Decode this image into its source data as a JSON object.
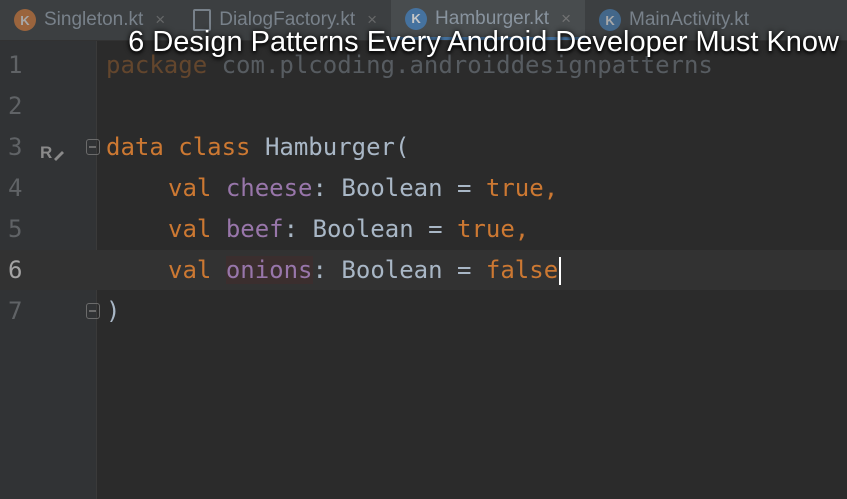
{
  "tabs": [
    {
      "label": "Singleton.kt",
      "icon": "kotlin-file-icon",
      "active": false
    },
    {
      "label": "DialogFactory.kt",
      "icon": "kotlin-class-file-icon",
      "active": false
    },
    {
      "label": "Hamburger.kt",
      "icon": "kotlin-file-icon",
      "active": true
    },
    {
      "label": "MainActivity.kt",
      "icon": "kotlin-file-icon",
      "active": false
    }
  ],
  "tab_close_glyph": "×",
  "video_title": "6 Design Patterns Every Android Developer Must Know",
  "editor": {
    "current_line": 6,
    "lines": [
      {
        "num": "1",
        "kw1": "package",
        "rest": " com.plcoding.androiddesignpatterns"
      },
      {
        "num": "2"
      },
      {
        "num": "3",
        "kw1": "data class",
        "rest": " Hamburger("
      },
      {
        "num": "4",
        "kw1": "val",
        "prop": "cheese",
        "type": ": Boolean = ",
        "value": "true",
        "tail": ","
      },
      {
        "num": "5",
        "kw1": "val",
        "prop": "beef",
        "type": ": Boolean = ",
        "value": "true",
        "tail": ","
      },
      {
        "num": "6",
        "kw1": "val",
        "prop": "onions",
        "type": ": Boolean = ",
        "value": "false",
        "tail": ""
      },
      {
        "num": "7",
        "rest": ")"
      }
    ],
    "gutter_marker_line3": "R"
  },
  "colors": {
    "keyword": "#cc7832",
    "property": "#9876aa",
    "text": "#a9b7c6",
    "background": "#2b2b2b",
    "gutter": "#313335",
    "kotlin_icon_orange": "#e8833a",
    "kotlin_icon_blue": "#4a88c7"
  }
}
